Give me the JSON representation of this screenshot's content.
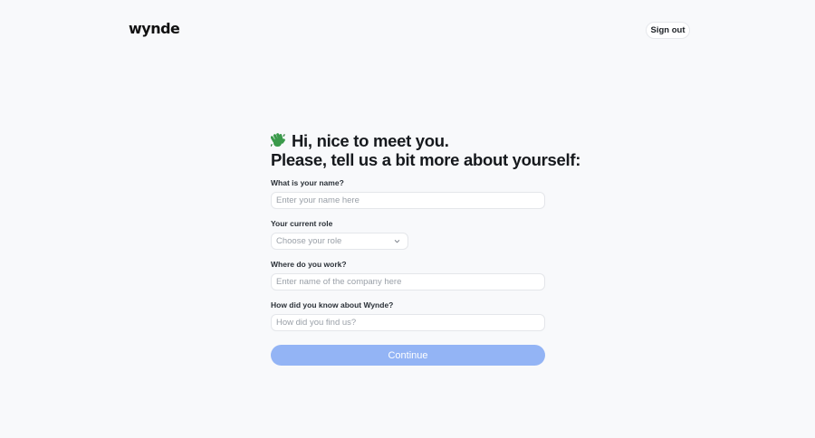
{
  "header": {
    "logo_text": "wynde",
    "signout_label": "Sign out"
  },
  "form": {
    "greeting": "Hi, nice to meet you.",
    "subheading": "Please, tell us a bit more about yourself:",
    "wave_icon": "waving-hand-icon",
    "name": {
      "label": "What is your name?",
      "placeholder": "Enter your name here"
    },
    "role": {
      "label": "Your current role",
      "placeholder": "Choose your role"
    },
    "company": {
      "label": "Where do you work?",
      "placeholder": "Enter name of the company here"
    },
    "source": {
      "label": "How did you know about Wynde?",
      "placeholder": "How did you find us?"
    },
    "continue_label": "Continue"
  },
  "colors": {
    "background": "#f8f9fb",
    "button": "#93b4f5",
    "wave": "#3a9a4a"
  }
}
